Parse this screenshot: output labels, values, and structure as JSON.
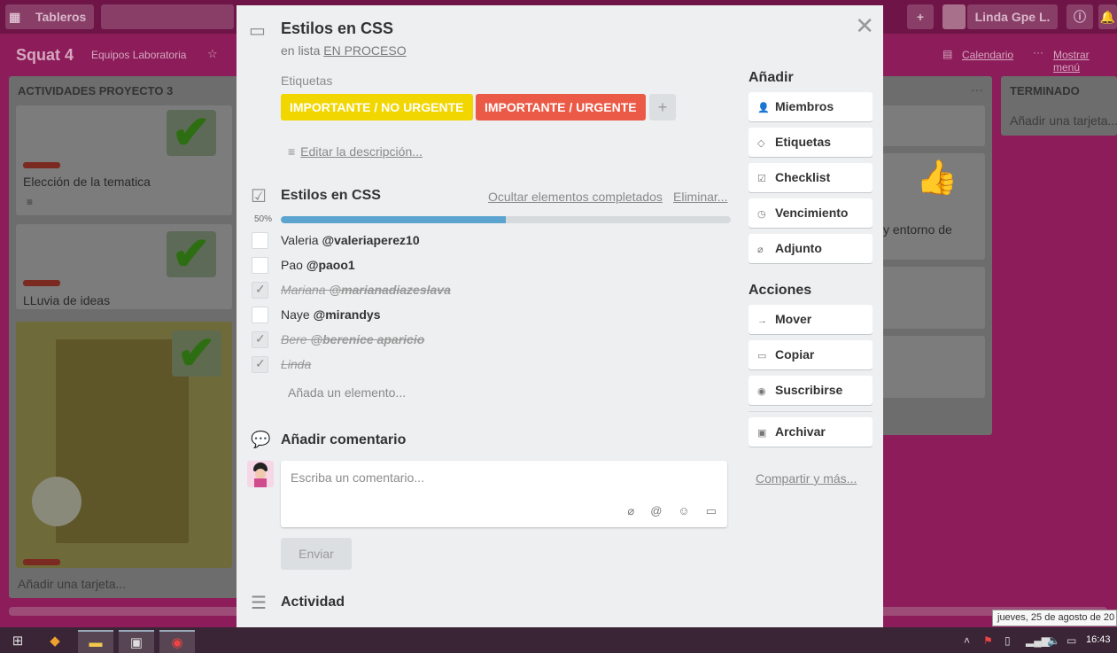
{
  "topbar": {
    "boards_label": "Tableros",
    "user_name": "Linda Gpe L."
  },
  "board": {
    "title": "Squat 4",
    "team": "Equipos Laboratoria",
    "calendar_label": "Calendario",
    "menu_label": "Mostrar menú",
    "lists": [
      {
        "title": "ACTIVIDADES PROYECTO 3",
        "cards": [
          {
            "text": "Elección de la tematica"
          },
          {
            "text": "LLuvia de ideas"
          }
        ],
        "add_card": "Añadir una tarjeta..."
      },
      {
        "title": "",
        "card_text": "y entorno de"
      },
      {
        "title": "TERMINADO",
        "add_card": "Añadir una tarjeta..."
      }
    ]
  },
  "modal": {
    "title": "Estilos en CSS",
    "in_list_prefix": "en lista",
    "in_list_name": "EN PROCESO",
    "labels_heading": "Etiquetas",
    "labels": [
      {
        "text": "IMPORTANTE / NO URGENTE",
        "color": "#f2d600"
      },
      {
        "text": "IMPORTANTE / URGENTE",
        "color": "#eb5a46"
      }
    ],
    "add_label": "+",
    "edit_description": "Editar la descripción...",
    "checklist": {
      "title": "Estilos en CSS",
      "hide_completed": "Ocultar elementos completados",
      "delete": "Eliminar...",
      "progress_text": "50%",
      "progress": 0.5,
      "items": [
        {
          "name": "Valeria",
          "mention": "@valeriaperez10",
          "done": false
        },
        {
          "name": "Pao",
          "mention": "@paoo1",
          "done": false
        },
        {
          "name": "Mariana",
          "mention": "@marianadiazeslava",
          "done": true
        },
        {
          "name": "Naye",
          "mention": "@mirandys",
          "done": false
        },
        {
          "name": "Bere",
          "mention": "@berenice aparicio",
          "done": true
        },
        {
          "name": "Linda",
          "mention": "",
          "done": true
        }
      ],
      "add_item": "Añada un elemento..."
    },
    "comment": {
      "heading": "Añadir comentario",
      "placeholder": "Escriba un comentario...",
      "send": "Enviar"
    },
    "activity_heading": "Actividad",
    "sidebar": {
      "add_heading": "Añadir",
      "add_buttons": [
        {
          "label": "Miembros",
          "icon": "person-icon"
        },
        {
          "label": "Etiquetas",
          "icon": "tag-icon"
        },
        {
          "label": "Checklist",
          "icon": "checkbox-icon"
        },
        {
          "label": "Vencimiento",
          "icon": "clock-icon"
        },
        {
          "label": "Adjunto",
          "icon": "paperclip-icon"
        }
      ],
      "actions_heading": "Acciones",
      "action_buttons": [
        {
          "label": "Mover",
          "icon": "arrow-right-icon"
        },
        {
          "label": "Copiar",
          "icon": "card-icon"
        },
        {
          "label": "Suscribirse",
          "icon": "eye-icon"
        },
        {
          "label": "Archivar",
          "icon": "archive-icon"
        }
      ],
      "share_link": "Compartir y más..."
    }
  },
  "taskbar": {
    "time": "16:43",
    "date_tooltip": "jueves, 25 de agosto de 20"
  }
}
